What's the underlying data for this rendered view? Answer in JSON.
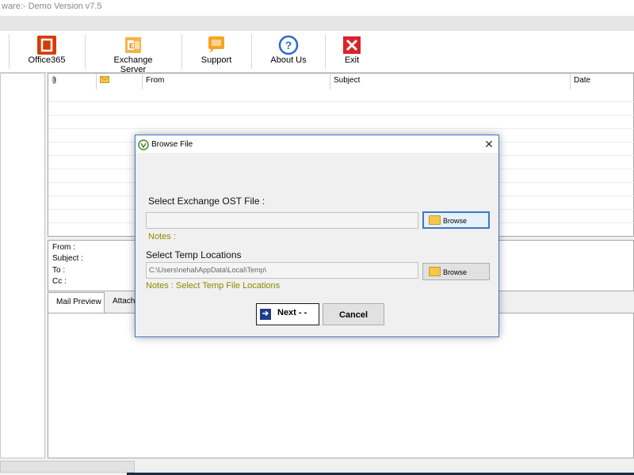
{
  "window": {
    "title": "ware:- Demo Version v7.5"
  },
  "toolbar": {
    "items": [
      {
        "label": "Office365",
        "icon": "office365-icon"
      },
      {
        "label": "Exchange Server",
        "icon": "exchange-server-icon"
      },
      {
        "label": "Support",
        "icon": "support-chat-icon"
      },
      {
        "label": "About Us",
        "icon": "question-icon"
      },
      {
        "label": "Exit",
        "icon": "exit-icon"
      }
    ]
  },
  "mail_list": {
    "columns": [
      "",
      "",
      "From",
      "Subject",
      "Date"
    ],
    "attachment_icon": "paperclip-icon",
    "envelope_icon": "envelope-icon"
  },
  "info_pane": {
    "from_label": "From :",
    "subject_label": "Subject :",
    "to_label": "To :",
    "cc_label": "Cc :"
  },
  "tabs": [
    {
      "label": "Mail Preview",
      "active": true
    },
    {
      "label": "Attachm",
      "active": false
    }
  ],
  "dialog": {
    "title": "Browse File",
    "close_symbol": "✕",
    "ost_label": "Select Exchange OST File :",
    "ost_value": "",
    "browse_label": "Browse",
    "ost_note": "Notes :",
    "temp_label": "Select Temp Locations",
    "temp_value": "C:\\Users\\nehal\\AppData\\Local\\Temp\\",
    "temp_note": "Notes :  Select Temp File Locations",
    "next_label": "Next - -",
    "cancel_label": "Cancel"
  },
  "colors": {
    "office_red": "#d83b01",
    "exchange_orange": "#f0a030",
    "support_orange": "#f5a623",
    "about_blue": "#2a6ccf",
    "exit_red": "#d9242a",
    "dialog_border": "#3c78c8",
    "note_olive": "#8a8a00"
  }
}
